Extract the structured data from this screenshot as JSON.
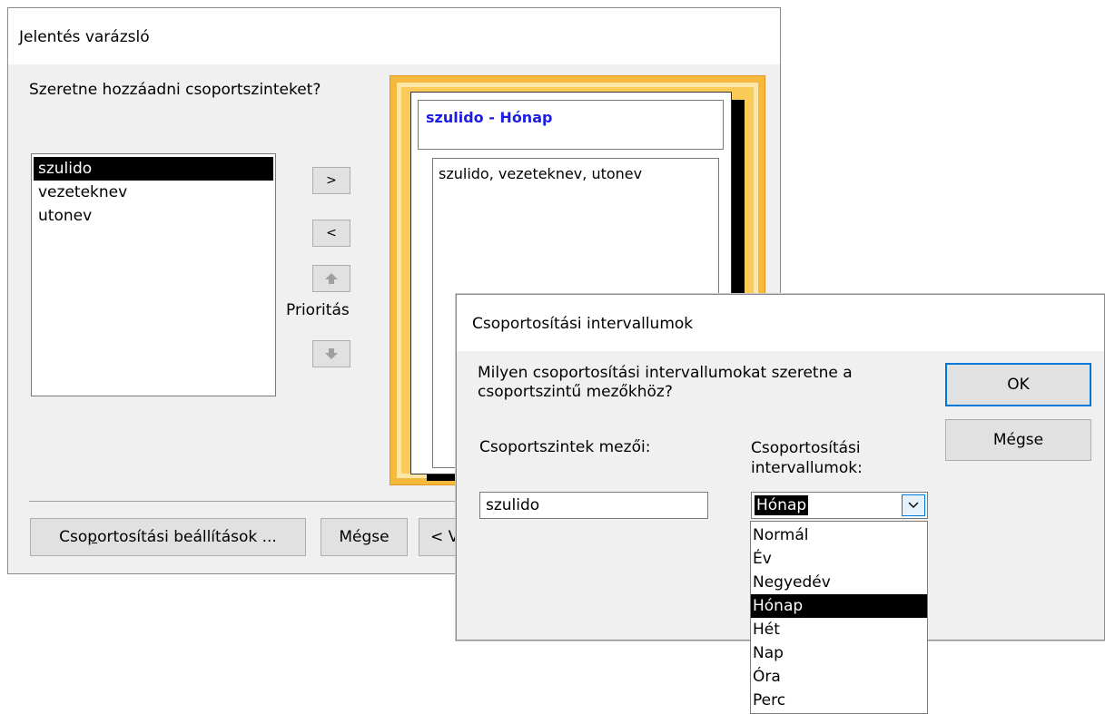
{
  "wizard": {
    "title": "Jelentés varázsló",
    "question": "Szeretne hozzáadni csoportszinteket?",
    "fields": [
      "szulido",
      "vezeteknev",
      "utonev"
    ],
    "selected_field": "szulido",
    "add_button": ">",
    "remove_button": "<",
    "priority_label": "Prioritás",
    "preview_group_header": "szulido - Hónap",
    "preview_detail": "szulido, vezeteknev, utonev",
    "group_options_button_pre": "Cso",
    "group_options_button_mnemonic": "p",
    "group_options_button_post": "ortosítási beállítások ...",
    "cancel_button": "Mégse",
    "back_button_partial": "< V",
    "colors": {
      "accent_frame": "#f6b93b",
      "header_text": "#1c1ce6"
    }
  },
  "interval_dialog": {
    "title": "Csoportosítási intervallumok",
    "question": "Milyen csoportosítási intervallumokat szeretne a csoportszintű mezőkhöz?",
    "ok_button": "OK",
    "cancel_button": "Mégse",
    "fields_label": "Csoportszintek mezői:",
    "intervals_label": "Csoportosítási intervallumok:",
    "field_value": "szulido",
    "interval_value": "Hónap",
    "interval_options": [
      "Normál",
      "Év",
      "Negyedév",
      "Hónap",
      "Hét",
      "Nap",
      "Óra",
      "Perc"
    ],
    "selected_interval": "Hónap"
  }
}
